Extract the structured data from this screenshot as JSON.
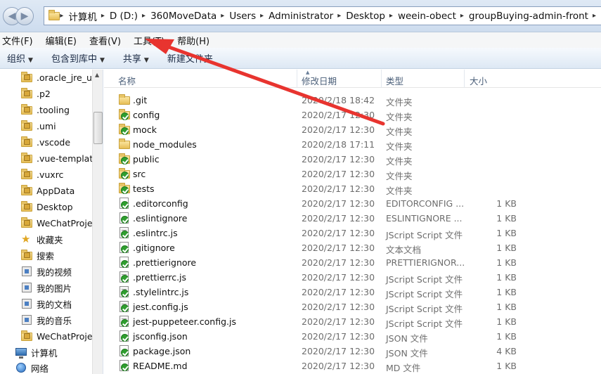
{
  "address_bar": {
    "crumbs": [
      "计算机",
      "D (D:)",
      "360MoveData",
      "Users",
      "Administrator",
      "Desktop",
      "weein-obect",
      "groupBuying-admin-front"
    ]
  },
  "menu": [
    "文件(F)",
    "编辑(E)",
    "查看(V)",
    "工具(T)",
    "帮助(H)"
  ],
  "toolbar": {
    "organize": "组织",
    "include_library": "包含到库中",
    "share": "共享",
    "new_folder": "新建文件夹"
  },
  "nav_pane": {
    "items": [
      {
        "label": ".oracle_jre_usa",
        "icon": "folder-lock-icon"
      },
      {
        "label": ".p2",
        "icon": "folder-lock-icon"
      },
      {
        "label": ".tooling",
        "icon": "folder-lock-icon"
      },
      {
        "label": ".umi",
        "icon": "folder-lock-icon"
      },
      {
        "label": ".vscode",
        "icon": "folder-lock-icon"
      },
      {
        "label": ".vue-templates",
        "icon": "folder-lock-icon"
      },
      {
        "label": ".vuxrc",
        "icon": "folder-lock-icon"
      },
      {
        "label": "AppData",
        "icon": "folder-lock-icon"
      },
      {
        "label": "Desktop",
        "icon": "folder-lock-icon"
      },
      {
        "label": "WeChatProjects",
        "icon": "folder-lock-icon"
      },
      {
        "label": "收藏夹",
        "icon": "star-icon"
      },
      {
        "label": "搜索",
        "icon": "folder-lock-icon"
      },
      {
        "label": "我的视频",
        "icon": "media-icon"
      },
      {
        "label": "我的图片",
        "icon": "media-icon"
      },
      {
        "label": "我的文档",
        "icon": "media-icon"
      },
      {
        "label": "我的音乐",
        "icon": "media-icon"
      },
      {
        "label": "WeChatProjects",
        "icon": "folder-lock-icon"
      }
    ],
    "computer": "计算机",
    "network": "网络"
  },
  "columns": {
    "name": "名称",
    "date": "修改日期",
    "type": "类型",
    "size": "大小"
  },
  "files": [
    {
      "name": ".git",
      "date": "2020/2/18 18:42",
      "type": "文件夹",
      "size": "",
      "icon": "folder-icon"
    },
    {
      "name": "config",
      "date": "2020/2/17 12:30",
      "type": "文件夹",
      "size": "",
      "icon": "folder-synced-icon"
    },
    {
      "name": "mock",
      "date": "2020/2/17 12:30",
      "type": "文件夹",
      "size": "",
      "icon": "folder-synced-icon"
    },
    {
      "name": "node_modules",
      "date": "2020/2/18 17:11",
      "type": "文件夹",
      "size": "",
      "icon": "folder-icon"
    },
    {
      "name": "public",
      "date": "2020/2/17 12:30",
      "type": "文件夹",
      "size": "",
      "icon": "folder-synced-icon"
    },
    {
      "name": "src",
      "date": "2020/2/17 12:30",
      "type": "文件夹",
      "size": "",
      "icon": "folder-synced-icon"
    },
    {
      "name": "tests",
      "date": "2020/2/17 12:30",
      "type": "文件夹",
      "size": "",
      "icon": "folder-synced-icon"
    },
    {
      "name": ".editorconfig",
      "date": "2020/2/17 12:30",
      "type": "EDITORCONFIG ...",
      "size": "1 KB",
      "icon": "file-synced-icon"
    },
    {
      "name": ".eslintignore",
      "date": "2020/2/17 12:30",
      "type": "ESLINTIGNORE ...",
      "size": "1 KB",
      "icon": "file-synced-icon"
    },
    {
      "name": ".eslintrc.js",
      "date": "2020/2/17 12:30",
      "type": "JScript Script 文件",
      "size": "1 KB",
      "icon": "js-file-synced-icon"
    },
    {
      "name": ".gitignore",
      "date": "2020/2/17 12:30",
      "type": "文本文档",
      "size": "1 KB",
      "icon": "file-synced-icon"
    },
    {
      "name": ".prettierignore",
      "date": "2020/2/17 12:30",
      "type": "PRETTIERIGNOR...",
      "size": "1 KB",
      "icon": "file-synced-icon"
    },
    {
      "name": ".prettierrc.js",
      "date": "2020/2/17 12:30",
      "type": "JScript Script 文件",
      "size": "1 KB",
      "icon": "js-file-synced-icon"
    },
    {
      "name": ".stylelintrc.js",
      "date": "2020/2/17 12:30",
      "type": "JScript Script 文件",
      "size": "1 KB",
      "icon": "js-file-synced-icon"
    },
    {
      "name": "jest.config.js",
      "date": "2020/2/17 12:30",
      "type": "JScript Script 文件",
      "size": "1 KB",
      "icon": "js-file-synced-icon"
    },
    {
      "name": "jest-puppeteer.config.js",
      "date": "2020/2/17 12:30",
      "type": "JScript Script 文件",
      "size": "1 KB",
      "icon": "js-file-synced-icon"
    },
    {
      "name": "jsconfig.json",
      "date": "2020/2/17 12:30",
      "type": "JSON 文件",
      "size": "1 KB",
      "icon": "file-synced-icon"
    },
    {
      "name": "package.json",
      "date": "2020/2/17 12:30",
      "type": "JSON 文件",
      "size": "4 KB",
      "icon": "file-synced-icon"
    },
    {
      "name": "README.md",
      "date": "2020/2/17 12:30",
      "type": "MD 文件",
      "size": "1 KB",
      "icon": "file-synced-icon"
    }
  ],
  "colors": {
    "annotation_arrow": "#e8342f"
  }
}
